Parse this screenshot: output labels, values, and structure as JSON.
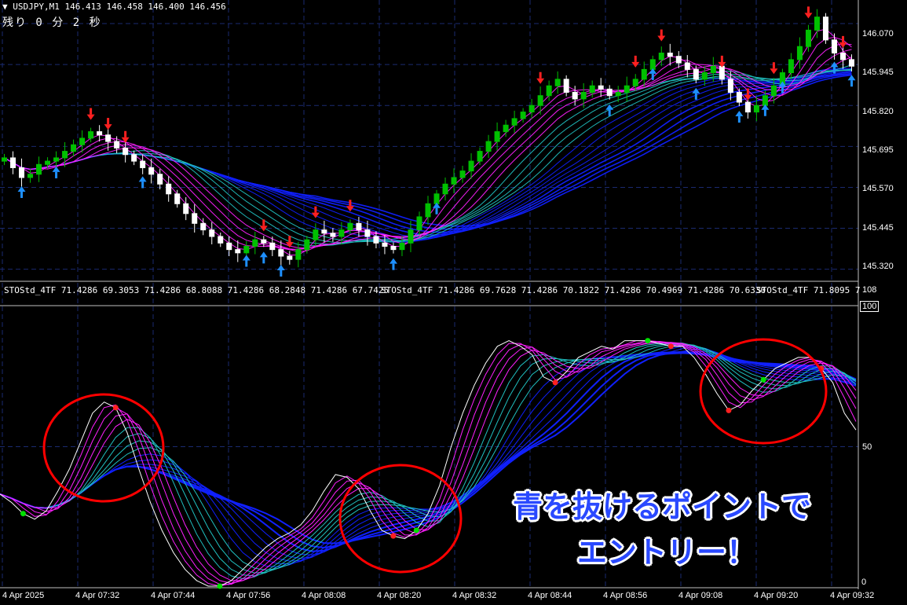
{
  "header": {
    "symbol_line": "USDJPY,M1  146.413 146.458 146.400 146.456",
    "timer": "残り 0 分 2 秒"
  },
  "price_axis": {
    "labels": [
      "146.070",
      "145.945",
      "145.820",
      "145.695",
      "145.570",
      "145.445",
      "145.320"
    ],
    "values": [
      146.07,
      145.945,
      145.82,
      145.695,
      145.57,
      145.445,
      145.32
    ]
  },
  "indicator": {
    "header": [
      "STOStd_4TF 71.4286 69.3053 71.4286 68.8088 71.4286 68.2848 71.4286 67.7425",
      "STOStd_4TF 71.4286 69.7628 71.4286 70.1822 71.4286 70.4969 71.4286 70.6330",
      "STOStd_4TF 71.8095 7"
    ],
    "scale_top": "108",
    "scale_max": "100",
    "scale_mid": "50",
    "scale_bottom": "0"
  },
  "time_axis": {
    "labels": [
      "4 Apr 2025",
      "4 Apr 07:32",
      "4 Apr 07:44",
      "4 Apr 07:56",
      "4 Apr 08:08",
      "4 Apr 08:20",
      "4 Apr 08:32",
      "4 Apr 08:44",
      "4 Apr 08:56",
      "4 Apr 09:08",
      "4 Apr 09:20",
      "4 Apr 09:32"
    ]
  },
  "caption": {
    "line1": "青を抜けるポイントで",
    "line2": "エントリー！"
  },
  "chart_data": [
    {
      "type": "candlestick",
      "symbol": "USDJPY",
      "timeframe": "M1",
      "close_path": [
        145.66,
        145.63,
        145.6,
        145.61,
        145.64,
        145.65,
        145.66,
        145.68,
        145.7,
        145.72,
        145.74,
        145.73,
        145.71,
        145.69,
        145.67,
        145.65,
        145.63,
        145.61,
        145.58,
        145.55,
        145.52,
        145.49,
        145.46,
        145.44,
        145.42,
        145.4,
        145.38,
        145.37,
        145.39,
        145.41,
        145.4,
        145.38,
        145.36,
        145.35,
        145.38,
        145.41,
        145.44,
        145.43,
        145.42,
        145.44,
        145.46,
        145.44,
        145.42,
        145.4,
        145.39,
        145.38,
        145.4,
        145.44,
        145.48,
        145.52,
        145.55,
        145.58,
        145.6,
        145.62,
        145.65,
        145.68,
        145.71,
        145.74,
        145.76,
        145.78,
        145.8,
        145.82,
        145.85,
        145.88,
        145.9,
        145.86,
        145.84,
        145.86,
        145.88,
        145.87,
        145.85,
        145.86,
        145.88,
        145.9,
        145.93,
        145.96,
        145.98,
        145.97,
        145.95,
        145.93,
        145.9,
        145.92,
        145.94,
        145.9,
        145.86,
        145.83,
        145.8,
        145.82,
        145.85,
        145.88,
        145.92,
        145.96,
        146.0,
        146.05,
        146.09,
        146.02,
        145.98,
        145.96,
        145.94
      ],
      "ylim": [
        145.3,
        146.13
      ]
    },
    {
      "type": "line",
      "name": "STOStd_4TF",
      "main_line": [
        33,
        30,
        26,
        24,
        27,
        34,
        42,
        52,
        62,
        66,
        64,
        55,
        42,
        30,
        20,
        12,
        6,
        2,
        0,
        0,
        2,
        6,
        10,
        14,
        17,
        19,
        22,
        27,
        34,
        40,
        39,
        35,
        27,
        20,
        18,
        17,
        20,
        26,
        36,
        50,
        62,
        72,
        80,
        86,
        88,
        86,
        83,
        75,
        73,
        77,
        82,
        84,
        86,
        85,
        88,
        88,
        88,
        87,
        86,
        86,
        82,
        76,
        69,
        63,
        65,
        70,
        74,
        78,
        80,
        82,
        82,
        78,
        73,
        62,
        56
      ],
      "ylim": [
        0,
        100
      ]
    }
  ],
  "colors": {
    "background": "#000000",
    "bull_candle": "#00c000",
    "bear_candle": "#ffffff",
    "sell_arrow": "#ff2020",
    "buy_arrow": "#1e90ff",
    "ribbon_blue": "#1020ff",
    "ribbon_magenta": "#ff20ff",
    "ribbon_teal": "#20c0c0",
    "highlight_circle": "#ff0000",
    "caption_text": "#2a49ff"
  }
}
